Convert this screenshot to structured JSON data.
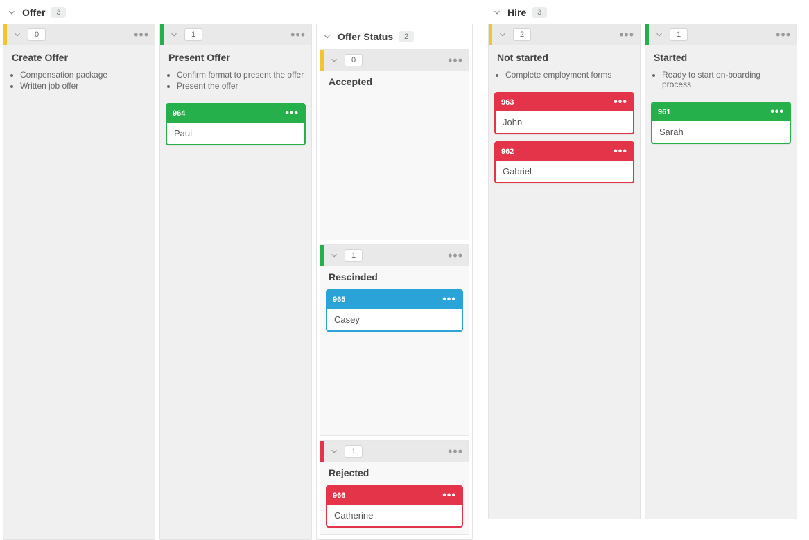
{
  "colors": {
    "green": "#25b04b",
    "red": "#e4344a",
    "blue": "#29a3d8",
    "yellow_accent": "#f4c430"
  },
  "boards": [
    {
      "title": "Offer",
      "count": 3,
      "lanes": [
        {
          "type": "simple",
          "accent": "#f4c430",
          "count": 0,
          "title": "Create Offer",
          "bullets": [
            "Compensation package",
            "Written job offer"
          ],
          "cards": []
        },
        {
          "type": "simple",
          "accent": "#25b04b",
          "count": 1,
          "title": "Present Offer",
          "bullets": [
            "Confirm format to present the offer",
            "Present the offer"
          ],
          "cards": [
            {
              "id": "964",
              "name": "Paul",
              "color": "green"
            }
          ]
        },
        {
          "type": "nested",
          "title": "Offer Status",
          "count": 2,
          "sublanes": [
            {
              "accent": "#f4c430",
              "count": 0,
              "title": "Accepted",
              "cards": [],
              "spacer": "spacer-200"
            },
            {
              "accent": "#25b04b",
              "count": 1,
              "title": "Rescinded",
              "cards": [
                {
                  "id": "965",
                  "name": "Casey",
                  "color": "blue"
                }
              ],
              "spacer": "spacer-130"
            },
            {
              "accent": "#e4344a",
              "count": 1,
              "title": "Rejected",
              "cards": [
                {
                  "id": "966",
                  "name": "Catherine",
                  "color": "red"
                }
              ]
            }
          ]
        }
      ]
    },
    {
      "title": "Hire",
      "count": 3,
      "lanes": [
        {
          "type": "simple",
          "accent": "#f4c430",
          "count": 2,
          "title": "Not started",
          "bullets": [
            "Complete employment forms"
          ],
          "cards": [
            {
              "id": "963",
              "name": "John",
              "color": "red"
            },
            {
              "id": "962",
              "name": "Gabriel",
              "color": "red"
            }
          ]
        },
        {
          "type": "simple",
          "accent": "#25b04b",
          "count": 1,
          "title": "Started",
          "bullets": [
            "Ready to start on-boarding process"
          ],
          "cards": [
            {
              "id": "961",
              "name": "Sarah",
              "color": "green"
            }
          ]
        }
      ]
    }
  ]
}
